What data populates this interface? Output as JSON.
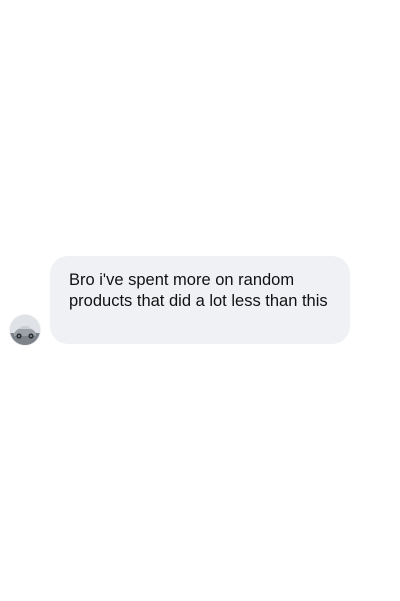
{
  "conversation": {
    "messages": [
      {
        "sender": "other",
        "avatar_icon": "car-photo-avatar",
        "text": "Bro i've spent more on random products that did a lot less than this"
      }
    ]
  },
  "colors": {
    "page_background": "#ffffff",
    "bubble_background": "#f0f1f5",
    "text": "#111111"
  }
}
